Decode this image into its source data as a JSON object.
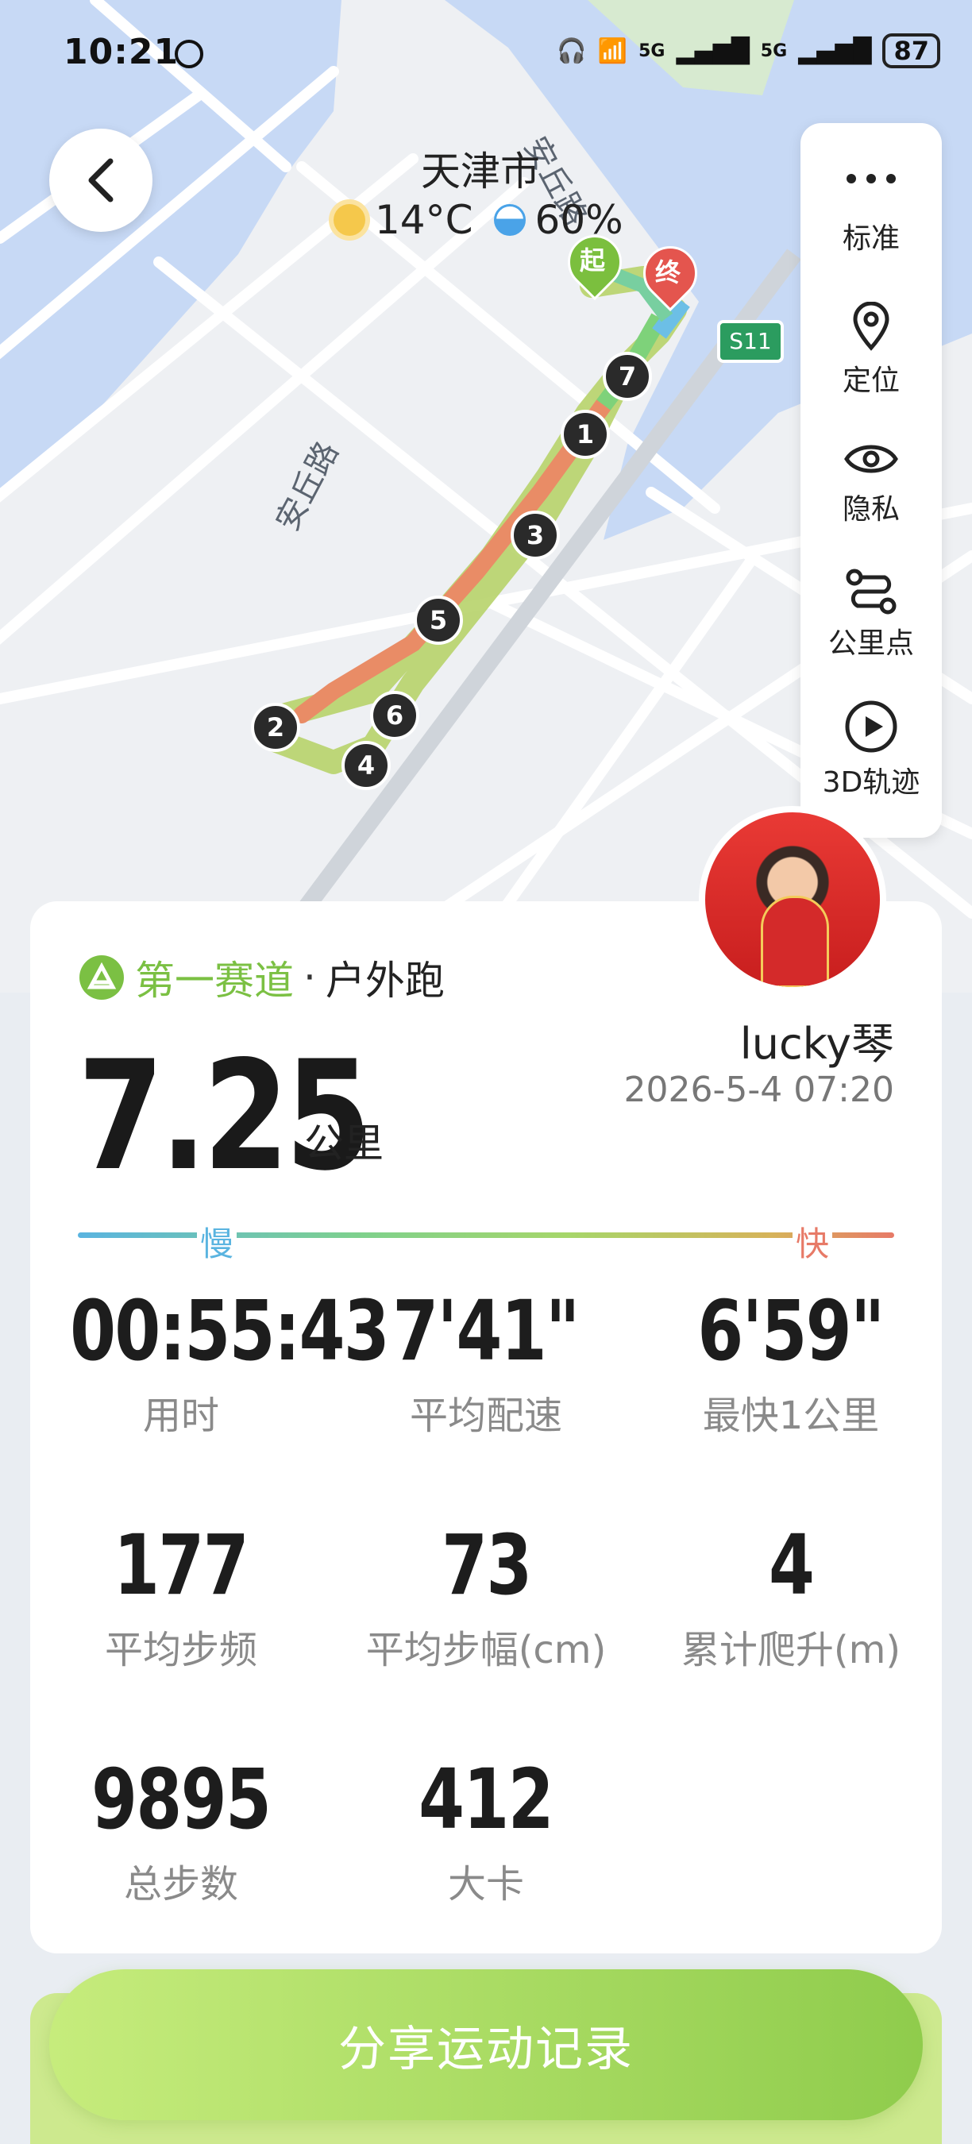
{
  "status_bar": {
    "time": "10:21",
    "battery": "87",
    "net1": "5G",
    "net2": "5G"
  },
  "map": {
    "city": "天津市",
    "temperature": "14°C",
    "humidity": "60%",
    "road_label_1": "安丘路",
    "road_label_2": "安丘路",
    "highway": "S11",
    "start_label": "起",
    "end_label": "终",
    "km_markers": [
      "1",
      "2",
      "3",
      "4",
      "5",
      "6",
      "7"
    ]
  },
  "side_panel": {
    "items": [
      {
        "label": "标准",
        "icon": "more-icon"
      },
      {
        "label": "定位",
        "icon": "location-pin-icon"
      },
      {
        "label": "隐私",
        "icon": "eye-icon"
      },
      {
        "label": "公里点",
        "icon": "route-points-icon"
      },
      {
        "label": "3D轨迹",
        "icon": "play-icon"
      }
    ]
  },
  "card": {
    "brand_name": "第一赛道",
    "separator": "·",
    "activity_type": "户外跑",
    "user_name": "lucky琴",
    "datetime": "2026-5-4 07:20",
    "distance": "7.25",
    "distance_unit": "公里",
    "pace_slow": "慢",
    "pace_fast": "快",
    "stats": [
      {
        "value": "00:55:43",
        "label": "用时"
      },
      {
        "value": "7'41\"",
        "label": "平均配速"
      },
      {
        "value": "6'59\"",
        "label": "最快1公里"
      },
      {
        "value": "177",
        "label": "平均步频"
      },
      {
        "value": "73",
        "label": "平均步幅(cm)"
      },
      {
        "value": "4",
        "label": "累计爬升(m)"
      },
      {
        "value": "9895",
        "label": "总步数"
      },
      {
        "value": "412",
        "label": "大卡"
      }
    ]
  },
  "share_button": "分享运动记录",
  "colors": {
    "brand_green": "#7bc043",
    "slow": "#5ab4e0",
    "fast": "#e77a67"
  }
}
